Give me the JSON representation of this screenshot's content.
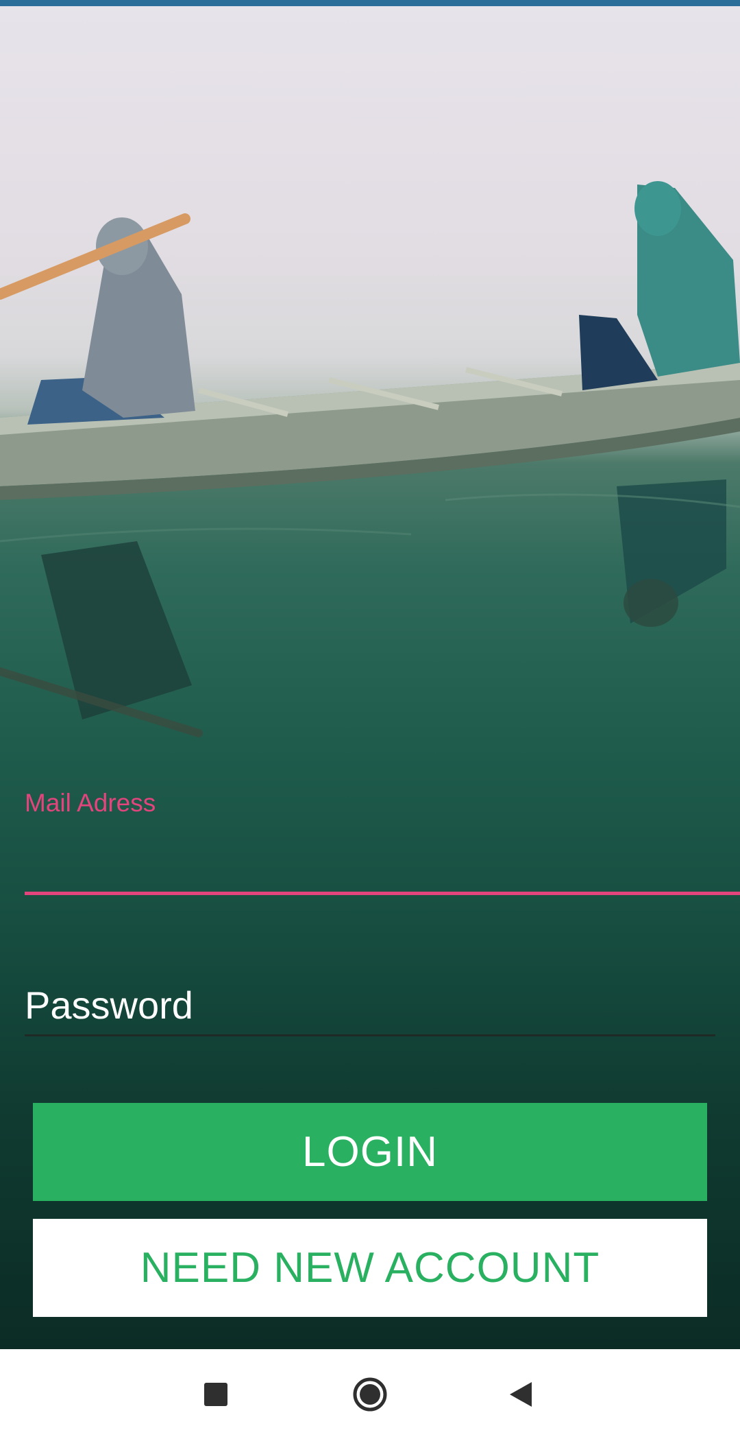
{
  "form": {
    "mail_label": "Mail Adress",
    "mail_value": "",
    "password_placeholder": "Password",
    "password_value": ""
  },
  "buttons": {
    "login_label": "LOGIN",
    "register_label": "NEED NEW ACCOUNT"
  },
  "nav": {
    "recents_icon": "square-icon",
    "home_icon": "circle-icon",
    "back_icon": "triangle-back-icon"
  },
  "colors": {
    "accent_pink": "#e2457c",
    "primary_green": "#29b060",
    "status_bar": "#2c6e9a"
  }
}
